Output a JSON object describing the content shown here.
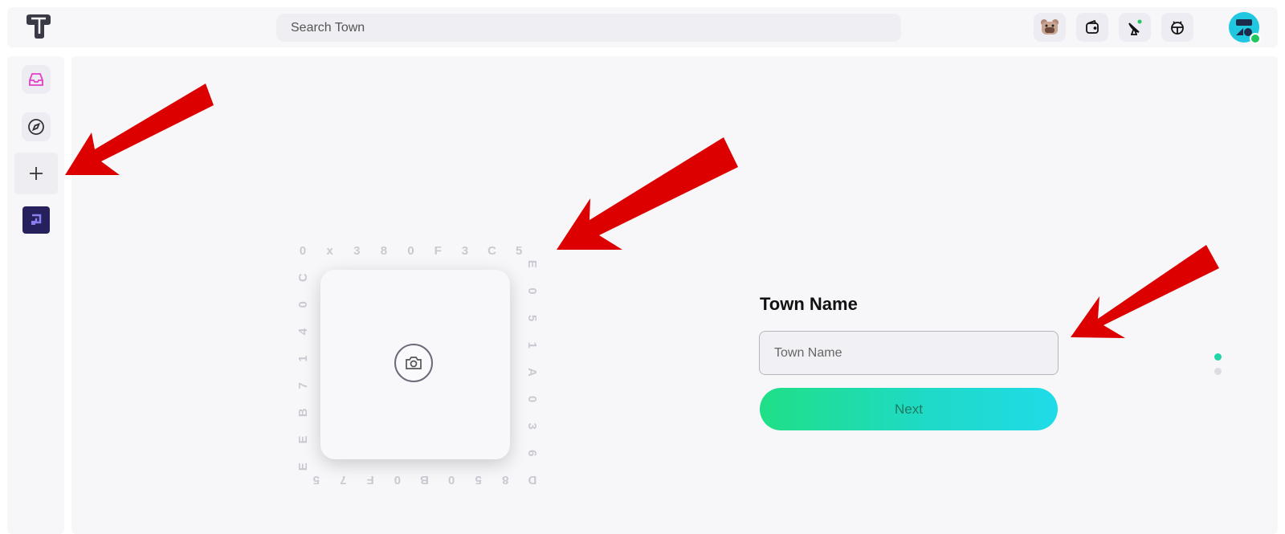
{
  "topbar": {
    "search_placeholder": "Search Town",
    "icons": [
      "bear-avatar-icon",
      "wallet-icon",
      "satellite-icon",
      "bug-icon"
    ]
  },
  "sidebar": {
    "items": [
      {
        "name": "inbox-icon"
      },
      {
        "name": "compass-icon"
      },
      {
        "name": "plus-icon"
      },
      {
        "name": "town-icon"
      }
    ]
  },
  "upload": {
    "ring_text": "0x380F3C5E051A036D850B0F75EEB7140C"
  },
  "form": {
    "title": "Town Name",
    "input_placeholder": "Town Name",
    "next_label": "Next"
  },
  "steps": {
    "total": 2,
    "current": 1
  },
  "colors": {
    "accent_green": "#1fdf86",
    "accent_cyan": "#1fdbe8",
    "arrow_red": "#dd0000",
    "inbox_pink": "#e040c8"
  }
}
